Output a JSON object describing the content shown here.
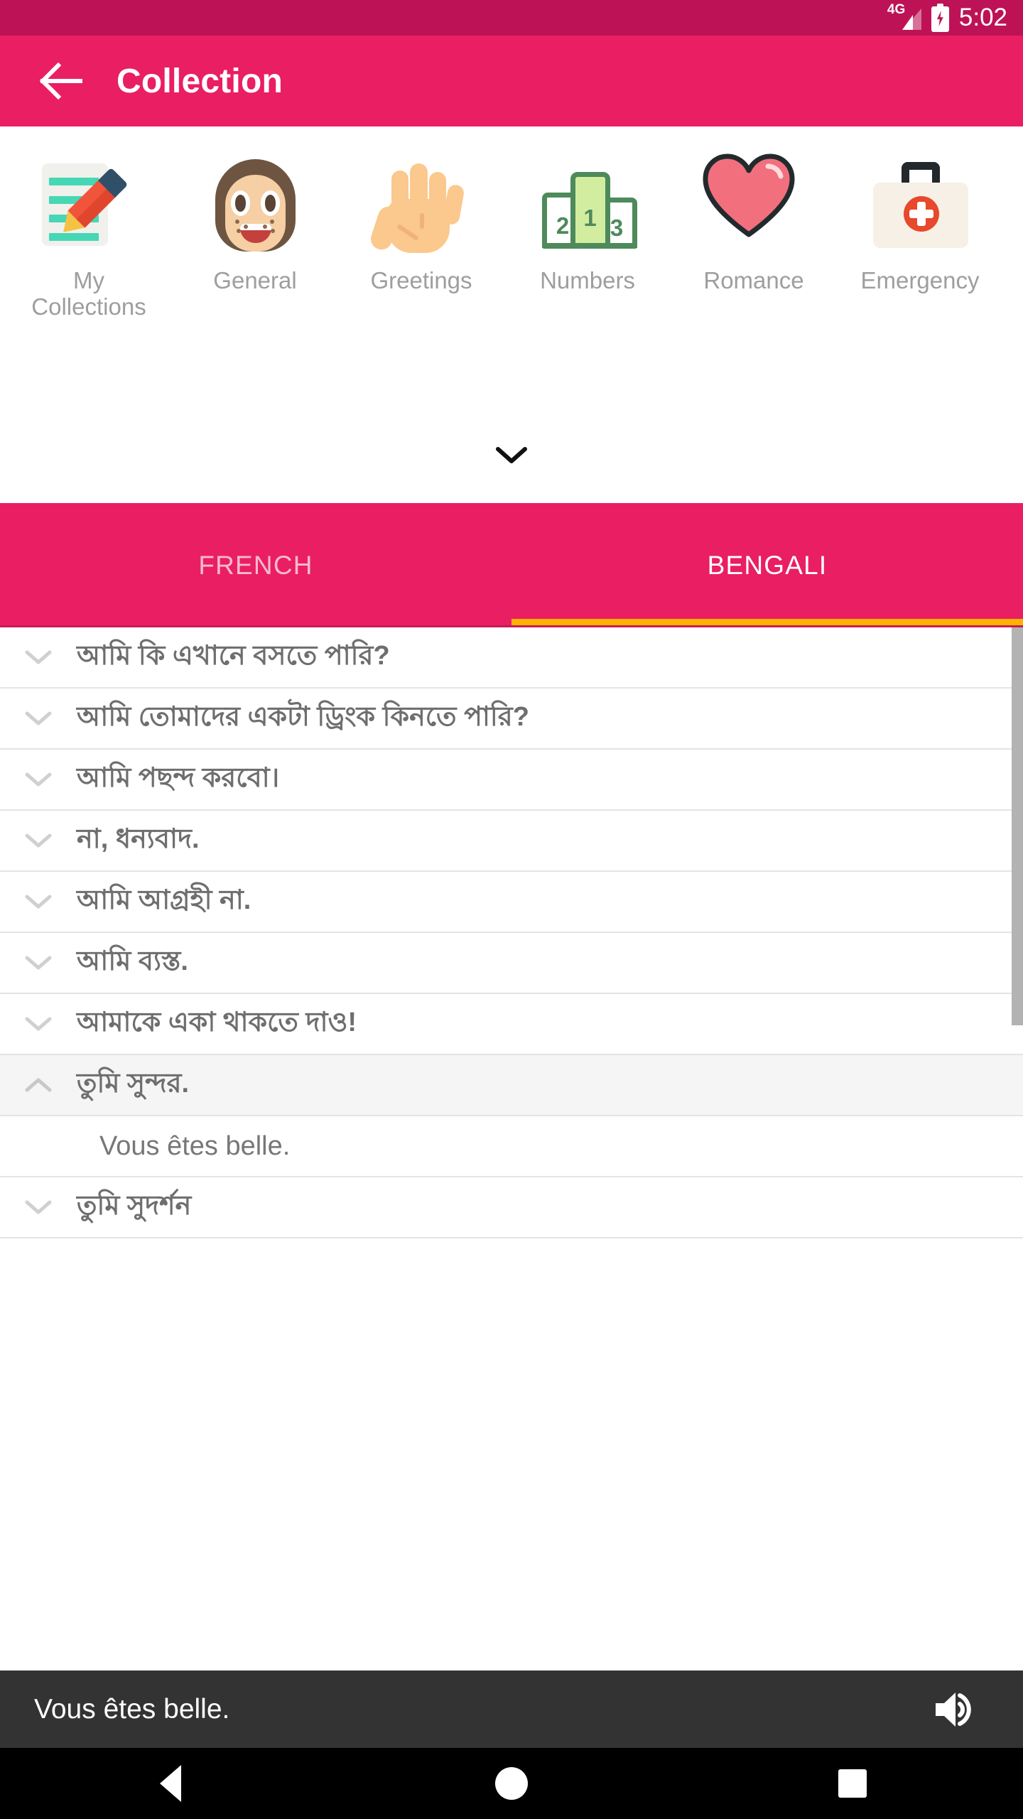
{
  "statusbar": {
    "network": "4G",
    "time": "5:02",
    "battery_icon": "battery-charging-icon",
    "signal_icon": "signal-bars-icon"
  },
  "appbar": {
    "back_icon": "back-arrow-icon",
    "title": "Collection"
  },
  "categories": {
    "expand_icon": "chevron-down-icon",
    "items": [
      {
        "label": "My Collections",
        "icon": "notes-pencil-icon"
      },
      {
        "label": "General",
        "icon": "person-face-icon"
      },
      {
        "label": "Greetings",
        "icon": "waving-hand-icon"
      },
      {
        "label": "Numbers",
        "icon": "podium-123-icon"
      },
      {
        "label": "Romance",
        "icon": "heart-icon"
      },
      {
        "label": "Emergency",
        "icon": "first-aid-kit-icon"
      }
    ]
  },
  "tabs": {
    "items": [
      {
        "label": "FRENCH",
        "active": false
      },
      {
        "label": "BENGALI",
        "active": true
      }
    ],
    "indicator_color": "#ffb300"
  },
  "list": {
    "collapse_icon": "chevron-up-icon",
    "expand_icon": "chevron-down-icon",
    "rows": [
      {
        "text": "আমি কি এখানে বসতে পারি?",
        "expanded": false
      },
      {
        "text": "আমি তোমাদের একটা ড্রিংক কিনতে পারি?",
        "expanded": false
      },
      {
        "text": "আমি পছন্দ করবো।",
        "expanded": false
      },
      {
        "text": "না, ধন্যবাদ.",
        "expanded": false
      },
      {
        "text": "আমি আগ্রহী না.",
        "expanded": false
      },
      {
        "text": "আমি ব্যস্ত.",
        "expanded": false
      },
      {
        "text": "আমাকে একা থাকতে দাও!",
        "expanded": false
      },
      {
        "text": "তুমি সুন্দর.",
        "expanded": true
      },
      {
        "text": "Vous êtes belle.",
        "translation": true
      },
      {
        "text": "তুমি সুদর্শন",
        "expanded": false,
        "partial": true
      }
    ]
  },
  "playbar": {
    "text": "Vous êtes belle.",
    "speaker_icon": "volume-up-icon"
  },
  "navbar": {
    "back_icon": "nav-back-triangle-icon",
    "home_icon": "nav-home-circle-icon",
    "recent_icon": "nav-recent-square-icon"
  },
  "colors": {
    "statusbar": "#bd1356",
    "appbar": "#e91e63",
    "tab_indicator": "#ffb300",
    "playbar": "#333333"
  }
}
